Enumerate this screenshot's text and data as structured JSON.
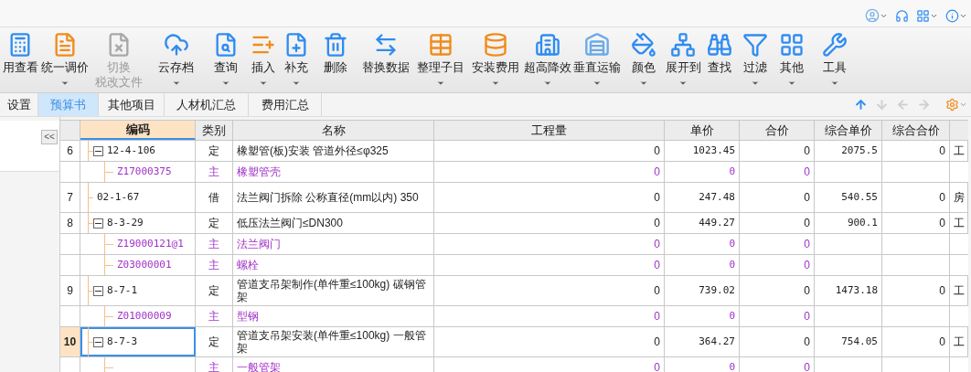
{
  "ribbon": [
    {
      "label": "用查看",
      "dropdown": false,
      "disabled": false
    },
    {
      "label": "统一调价",
      "dropdown": true,
      "disabled": false
    },
    {
      "label": "切换",
      "sublabel": "税改文件",
      "dropdown": false,
      "disabled": true
    },
    {
      "label": "云存档",
      "dropdown": true,
      "disabled": false
    },
    {
      "label": "查询",
      "dropdown": true,
      "disabled": false
    },
    {
      "label": "插入",
      "dropdown": true,
      "disabled": false
    },
    {
      "label": "补充",
      "dropdown": true,
      "disabled": false
    },
    {
      "label": "删除",
      "dropdown": false,
      "disabled": false
    },
    {
      "label": "替换数据",
      "dropdown": false,
      "disabled": false
    },
    {
      "label": "整理子目",
      "dropdown": true,
      "disabled": false
    },
    {
      "label": "安装费用",
      "dropdown": true,
      "disabled": false
    },
    {
      "label": "超高降效",
      "dropdown": true,
      "disabled": false
    },
    {
      "label": "垂直运输",
      "dropdown": true,
      "disabled": false
    },
    {
      "label": "颜色",
      "dropdown": true,
      "disabled": false
    },
    {
      "label": "展开到",
      "dropdown": true,
      "disabled": false
    },
    {
      "label": "查找",
      "dropdown": false,
      "disabled": false
    },
    {
      "label": "过滤",
      "dropdown": true,
      "disabled": false
    },
    {
      "label": "其他",
      "dropdown": true,
      "disabled": false
    },
    {
      "label": "工具",
      "dropdown": true,
      "disabled": false
    }
  ],
  "tabs": [
    {
      "label": "设置",
      "selected": false
    },
    {
      "label": "预算书",
      "selected": true
    },
    {
      "label": "其他项目",
      "selected": false
    },
    {
      "label": "人材机汇总",
      "selected": false
    },
    {
      "label": "费用汇总",
      "selected": false
    }
  ],
  "nav_arrows": [
    {
      "kind": "up",
      "disabled": false
    },
    {
      "kind": "down",
      "disabled": true
    },
    {
      "kind": "left",
      "disabled": true
    },
    {
      "kind": "right",
      "disabled": true
    }
  ],
  "table": {
    "columns": [
      "编码",
      "类别",
      "名称",
      "工程量",
      "单价",
      "合价",
      "综合单价",
      "综合合价"
    ],
    "rows": [
      {
        "number": "6",
        "kind": "item",
        "code": "12-4-106",
        "expanded": true,
        "selected": false,
        "type": "定",
        "name": "橡塑管(板)安装 管道外径≤φ325",
        "quantity": "0",
        "unit_price": "1023.45",
        "total": "0",
        "comp_unit_price": "2075.5",
        "comp_total": "0",
        "column_9": "工",
        "children": [
          {
            "kind": "material",
            "code": "Z17000375",
            "type": "主",
            "name": "橡塑管壳",
            "quantity": "0",
            "unit_price": "0",
            "total": "0"
          }
        ]
      },
      {
        "number": "7",
        "kind": "item",
        "code": "02-1-67",
        "selected": false,
        "type": "借",
        "name": "法兰阀门拆除 公称直径(mm以内) 350",
        "quantity": "0",
        "unit_price": "247.48",
        "total": "0",
        "comp_unit_price": "540.55",
        "comp_total": "0",
        "column_9": "房"
      },
      {
        "number": "8",
        "kind": "item",
        "code": "8-3-29",
        "expanded": true,
        "selected": false,
        "type": "定",
        "name": "低压法兰阀门≤DN300",
        "quantity": "0",
        "unit_price": "449.27",
        "total": "0",
        "comp_unit_price": "900.1",
        "comp_total": "0",
        "column_9": "工",
        "children": [
          {
            "kind": "material",
            "code": "Z19000121@1",
            "type": "主",
            "name": "法兰阀门",
            "quantity": "0",
            "unit_price": "0",
            "total": "0"
          },
          {
            "kind": "material",
            "code": "Z03000001",
            "type": "主",
            "name": "螺栓",
            "quantity": "0",
            "unit_price": "0",
            "total": "0"
          }
        ]
      },
      {
        "number": "9",
        "kind": "item",
        "code": "8-7-1",
        "expanded": true,
        "selected": false,
        "type": "定",
        "name": "管道支吊架制作(单件重≤100kg) 碳钢管架",
        "quantity": "0",
        "unit_price": "739.02",
        "total": "0",
        "comp_unit_price": "1473.18",
        "comp_total": "0",
        "column_9": "工",
        "children": [
          {
            "kind": "material",
            "code": "Z01000009",
            "type": "主",
            "name": "型钢",
            "quantity": "0",
            "unit_price": "0",
            "total": "0"
          }
        ]
      },
      {
        "number": "10",
        "kind": "item",
        "code": "8-7-3",
        "expanded": true,
        "selected": true,
        "type": "定",
        "name": "管道支吊架安装(单件重≤100kg) 一般管架",
        "quantity": "0",
        "unit_price": "364.27",
        "total": "0",
        "comp_unit_price": "754.05",
        "comp_total": "0",
        "column_9": "工",
        "children": [
          {
            "kind": "material",
            "type": "主",
            "name": "一般管架",
            "quantity": "0",
            "unit_price": "0",
            "total": "0"
          }
        ]
      }
    ]
  },
  "collapse_button": "<<"
}
